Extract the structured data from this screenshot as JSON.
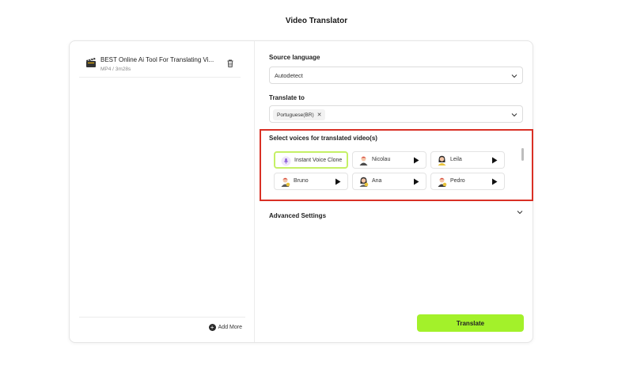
{
  "page": {
    "title": "Video Translator"
  },
  "file": {
    "name": "BEST Online Ai Tool For Translating Vi...",
    "meta": "MP4 / 3m28s"
  },
  "left_footer": {
    "add_more_label": "Add More"
  },
  "source_language": {
    "label": "Source language",
    "value": "Autodetect"
  },
  "translate_to": {
    "label": "Translate to",
    "chip": "Portuguese(BR)"
  },
  "voices": {
    "title": "Select voices for translated video(s)",
    "items": [
      {
        "name": "Instant Voice Clone",
        "selected": true,
        "icon": "microphone-icon"
      },
      {
        "name": "Nicolau",
        "icon": "avatar-icon"
      },
      {
        "name": "Leila",
        "icon": "avatar-icon"
      },
      {
        "name": "Bruno",
        "icon": "avatar-icon"
      },
      {
        "name": "Ana",
        "icon": "avatar-icon"
      },
      {
        "name": "Pedro",
        "icon": "avatar-icon"
      }
    ]
  },
  "advanced": {
    "label": "Advanced Settings"
  },
  "actions": {
    "translate_label": "Translate"
  },
  "colors": {
    "accent": "#a3f12a",
    "highlight": "#d93025",
    "selected_border": "#c5f066"
  }
}
